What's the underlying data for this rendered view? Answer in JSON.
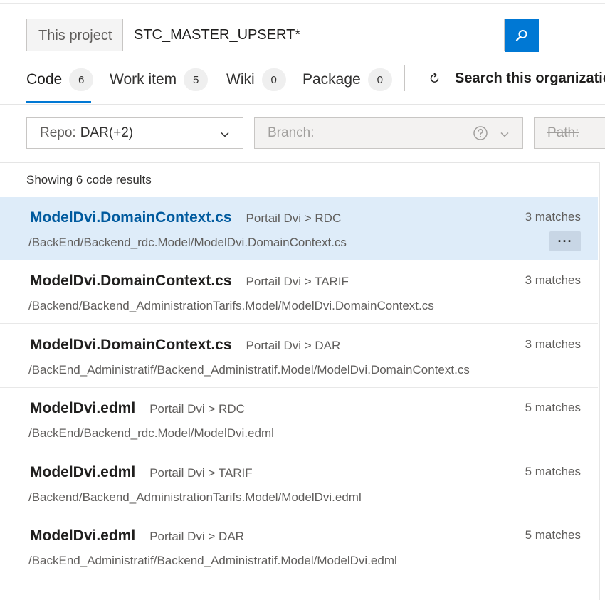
{
  "search": {
    "scope_label": "This project",
    "query": "STC_MASTER_UPSERT*",
    "button_icon": "search-icon"
  },
  "tabs": [
    {
      "label": "Code",
      "count": "6",
      "active": true
    },
    {
      "label": "Work item",
      "count": "5",
      "active": false
    },
    {
      "label": "Wiki",
      "count": "0",
      "active": false
    },
    {
      "label": "Package",
      "count": "0",
      "active": false
    }
  ],
  "org_search": {
    "label": "Search this organization",
    "icon": "refresh-arrow-icon"
  },
  "filters": {
    "repo": {
      "label": "Repo:",
      "value": "DAR(+2)"
    },
    "branch": {
      "label": "Branch:"
    },
    "path": {
      "label": "Path:"
    }
  },
  "summary": "Showing 6 code results",
  "results": [
    {
      "name": "ModelDvi.DomainContext.cs",
      "repo": "Portail Dvi > RDC",
      "path": "/BackEnd/Backend_rdc.Model/ModelDvi.DomainContext.cs",
      "matches": "3 matches",
      "selected": true,
      "more": "···"
    },
    {
      "name": "ModelDvi.DomainContext.cs",
      "repo": "Portail Dvi > TARIF",
      "path": "/Backend/Backend_AdministrationTarifs.Model/ModelDvi.DomainContext.cs",
      "matches": "3 matches"
    },
    {
      "name": "ModelDvi.DomainContext.cs",
      "repo": "Portail Dvi > DAR",
      "path": "/BackEnd_Administratif/Backend_Administratif.Model/ModelDvi.DomainContext.cs",
      "matches": "3 matches"
    },
    {
      "name": "ModelDvi.edml",
      "repo": "Portail Dvi > RDC",
      "path": "/BackEnd/Backend_rdc.Model/ModelDvi.edml",
      "matches": "5 matches"
    },
    {
      "name": "ModelDvi.edml",
      "repo": "Portail Dvi > TARIF",
      "path": "/Backend/Backend_AdministrationTarifs.Model/ModelDvi.edml",
      "matches": "5 matches"
    },
    {
      "name": "ModelDvi.edml",
      "repo": "Portail Dvi > DAR",
      "path": "/BackEnd_Administratif/Backend_Administratif.Model/ModelDvi.edml",
      "matches": "5 matches"
    }
  ],
  "colors": {
    "accent": "#0078d4",
    "selected_row": "#deecf9",
    "selected_title": "#005a9e"
  }
}
